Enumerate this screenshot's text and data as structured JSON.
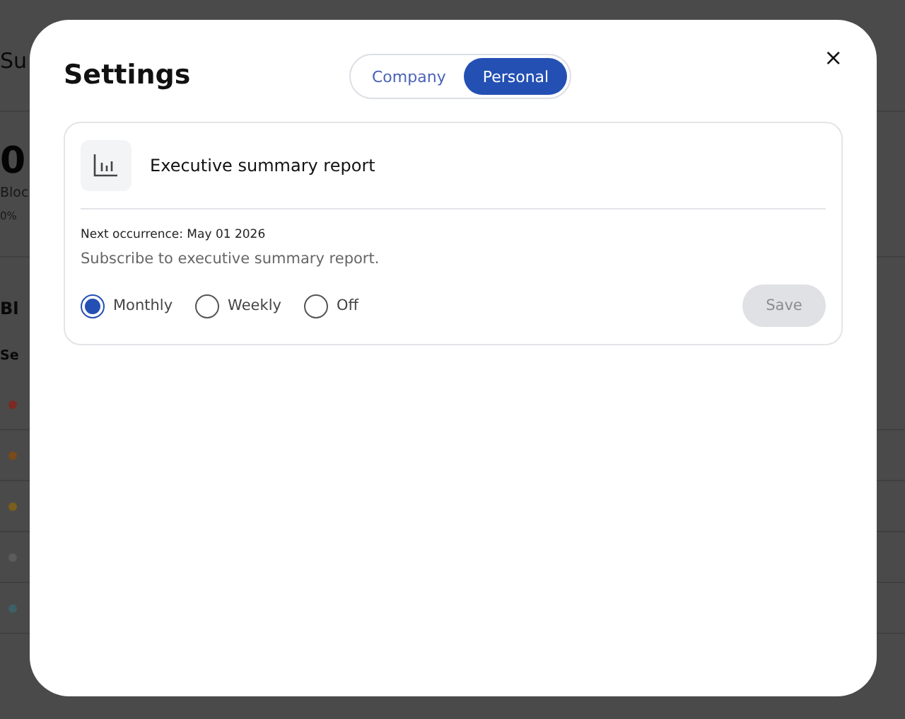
{
  "background": {
    "heading": "Su",
    "big_value": "0",
    "value_label": "Bloc",
    "change": "0%",
    "section_title": "Bl",
    "column_header": "Se",
    "status_dots": [
      {
        "color": "#7a2a22"
      },
      {
        "color": "#7a4a1c"
      },
      {
        "color": "#7a5e1c"
      },
      {
        "color": "#5c5c5c"
      },
      {
        "color": "#3d6066"
      }
    ]
  },
  "dialog": {
    "title": "Settings",
    "close": "×",
    "scope_tabs": [
      {
        "label": "Company",
        "selected": false
      },
      {
        "label": "Personal",
        "selected": true
      }
    ],
    "report": {
      "title": "Executive summary report",
      "next_occurrence": "Next occurrence: May 01 2026",
      "description": "Subscribe to executive summary report.",
      "frequency": [
        {
          "label": "Monthly",
          "selected": true
        },
        {
          "label": "Weekly",
          "selected": false
        },
        {
          "label": "Off",
          "selected": false
        }
      ],
      "save": {
        "label": "Save",
        "disabled": true
      }
    }
  }
}
